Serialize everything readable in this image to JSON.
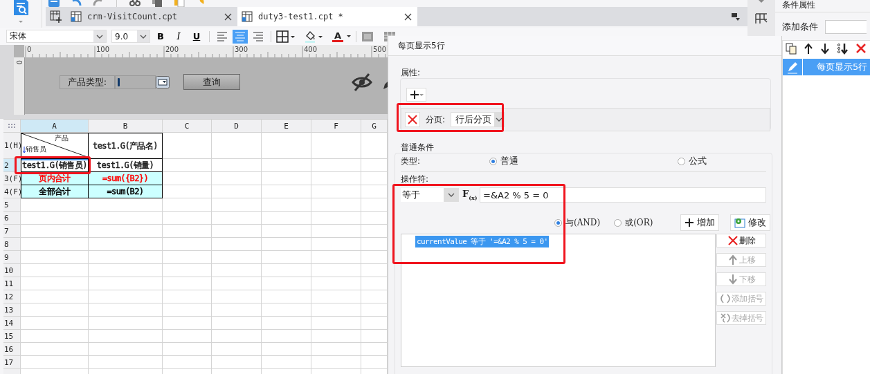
{
  "tabs": [
    {
      "label": "crm-VisitCount.cpt",
      "selected": false
    },
    {
      "label": "duty3-test1.cpt *",
      "selected": true
    }
  ],
  "format_bar": {
    "font": "宋体",
    "size": "9.0",
    "style_buttons": [
      "B",
      "I",
      "U"
    ],
    "align": [
      {
        "kind": "left",
        "selected": false
      },
      {
        "kind": "center",
        "selected": true
      },
      {
        "kind": "right",
        "selected": false
      }
    ],
    "color_button": "A"
  },
  "ruler": {
    "marks": [
      "0",
      "100",
      "200",
      "300",
      "400",
      "500"
    ],
    "side_mark": "0"
  },
  "parameter_pane": {
    "label": "产品类型:",
    "button": "查询"
  },
  "sheet": {
    "columns": [
      {
        "label": "A",
        "selected": true
      },
      {
        "label": "B",
        "selected": false
      },
      {
        "label": "C",
        "selected": false
      },
      {
        "label": "D",
        "selected": false
      },
      {
        "label": "E",
        "selected": false
      },
      {
        "label": "F",
        "selected": false
      },
      {
        "label": "G",
        "selected": false
      }
    ],
    "rows": [
      {
        "label": "1(H)",
        "selected": false
      },
      {
        "label": "2",
        "selected": true
      },
      {
        "label": "3(F)",
        "selected": false
      },
      {
        "label": "4(F)",
        "selected": false
      },
      {
        "label": "5",
        "selected": false
      },
      {
        "label": "6",
        "selected": false
      },
      {
        "label": "7",
        "selected": false
      },
      {
        "label": "8",
        "selected": false
      },
      {
        "label": "9",
        "selected": false
      },
      {
        "label": "10",
        "selected": false
      },
      {
        "label": "11",
        "selected": false
      },
      {
        "label": "12",
        "selected": false
      },
      {
        "label": "13",
        "selected": false
      },
      {
        "label": "14",
        "selected": false
      },
      {
        "label": "15",
        "selected": false
      },
      {
        "label": "16",
        "selected": false
      },
      {
        "label": "17",
        "selected": false
      }
    ],
    "cells": [
      [
        {
          "kind": "diagonal",
          "top": "产品",
          "bottom": "销售员"
        },
        {
          "kind": "header",
          "text": "test1.G(产品名)"
        }
      ],
      [
        {
          "kind": "data",
          "text": "test1.G(销售员)",
          "highlighted": true
        },
        {
          "kind": "data",
          "text": "test1.G(销量)",
          "highlighted": false
        }
      ],
      [
        {
          "kind": "summary",
          "text": "页内合计",
          "color": "#ff0000"
        },
        {
          "kind": "summary",
          "text": "=sum({B2})",
          "color": "#ff0000"
        }
      ],
      [
        {
          "kind": "summary",
          "text": "全部合计",
          "color": "#000000"
        },
        {
          "kind": "summary",
          "text": "=sum(B2)",
          "color": "#000000"
        }
      ]
    ]
  },
  "dialog": {
    "title": "每页显示5行",
    "properties": {
      "label": "属性:",
      "pagination": {
        "label": "分页:",
        "value": "行后分页",
        "highlighted": true
      }
    },
    "condition": {
      "title": "普通条件",
      "type_label": "类型:",
      "types": [
        {
          "label": "普通",
          "selected": true
        },
        {
          "label": "公式",
          "selected": false
        }
      ],
      "operator_label": "操作符:",
      "operator": "等于",
      "formula_button": "F$_{(x)}$",
      "operand": "=&A2 % 5 = 0",
      "highlighted": true,
      "joins": [
        {
          "label": "与(AND)",
          "selected": true
        },
        {
          "label": "或(OR)",
          "selected": false
        }
      ],
      "add_button": "增加",
      "modify_button": "修改",
      "conditions": [
        {
          "text": "currentValue 等于 '=&A2 % 5 = 0'",
          "selected": true
        }
      ],
      "side_buttons": [
        {
          "kind": "delete",
          "label": "删除",
          "disabled": false
        },
        {
          "kind": "up",
          "label": "上移",
          "disabled": true
        },
        {
          "kind": "down",
          "label": "下移",
          "disabled": true
        },
        {
          "kind": "add-bracket",
          "label": "添加括号",
          "disabled": true
        },
        {
          "kind": "remove-bracket",
          "label": "去掉括号",
          "disabled": true
        }
      ]
    }
  },
  "side_panel": {
    "title": "条件属性",
    "add_label": "添加条件",
    "items": [
      {
        "label": "每页显示5行",
        "selected": true
      }
    ]
  }
}
